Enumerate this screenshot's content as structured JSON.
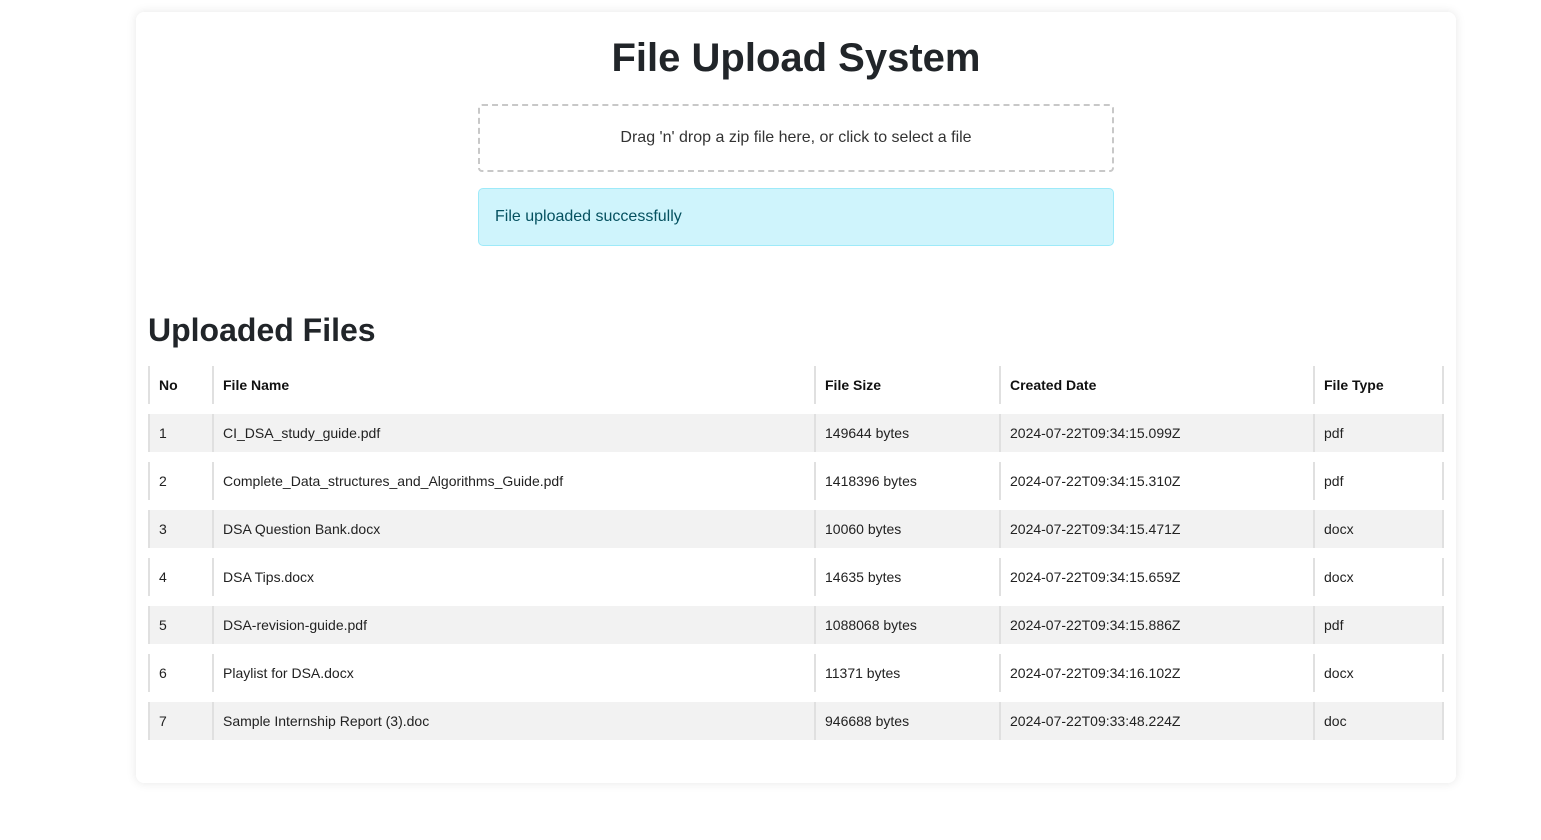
{
  "header": {
    "title": "File Upload System"
  },
  "dropzone": {
    "text": "Drag 'n' drop a zip file here, or click to select a file"
  },
  "alert": {
    "message": "File uploaded successfully",
    "background": "#cff4fc"
  },
  "files_section": {
    "title": "Uploaded Files",
    "columns": [
      "No",
      "File Name",
      "File Size",
      "Created Date",
      "File Type"
    ],
    "rows": [
      {
        "no": "1",
        "name": "CI_DSA_study_guide.pdf",
        "size": "149644 bytes",
        "created": "2024-07-22T09:34:15.099Z",
        "type": "pdf"
      },
      {
        "no": "2",
        "name": "Complete_Data_structures_and_Algorithms_Guide.pdf",
        "size": "1418396 bytes",
        "created": "2024-07-22T09:34:15.310Z",
        "type": "pdf"
      },
      {
        "no": "3",
        "name": "DSA Question Bank.docx",
        "size": "10060 bytes",
        "created": "2024-07-22T09:34:15.471Z",
        "type": "docx"
      },
      {
        "no": "4",
        "name": "DSA Tips.docx",
        "size": "14635 bytes",
        "created": "2024-07-22T09:34:15.659Z",
        "type": "docx"
      },
      {
        "no": "5",
        "name": "DSA-revision-guide.pdf",
        "size": "1088068 bytes",
        "created": "2024-07-22T09:34:15.886Z",
        "type": "pdf"
      },
      {
        "no": "6",
        "name": "Playlist for DSA.docx",
        "size": "11371 bytes",
        "created": "2024-07-22T09:34:16.102Z",
        "type": "docx"
      },
      {
        "no": "7",
        "name": "Sample Internship Report (3).doc",
        "size": "946688 bytes",
        "created": "2024-07-22T09:33:48.224Z",
        "type": "doc"
      }
    ]
  }
}
